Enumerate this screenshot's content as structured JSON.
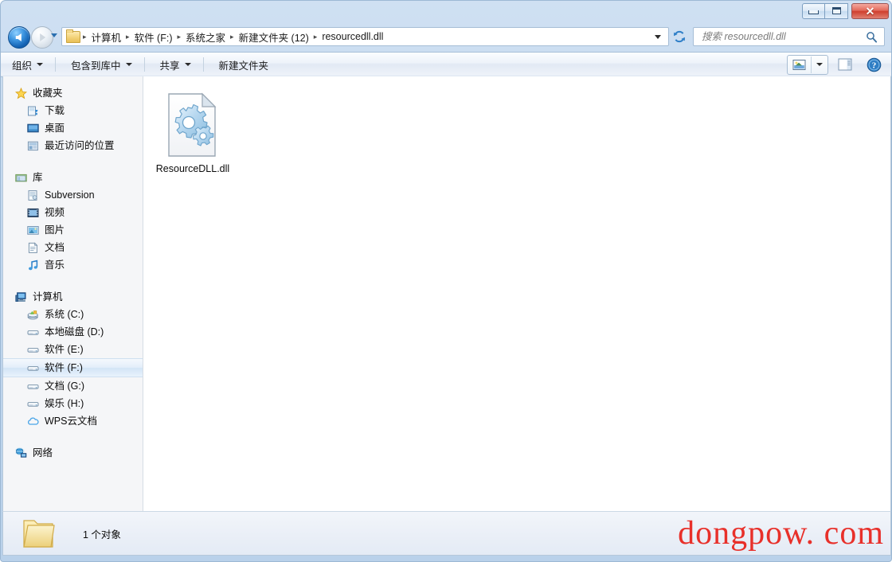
{
  "window": {
    "controls": {
      "minimize_label": "最小化",
      "maximize_label": "最大化",
      "close_label": "✕"
    }
  },
  "navigation": {
    "back_tooltip": "后退",
    "forward_tooltip": "前进",
    "history_tooltip": "最近浏览的位置",
    "refresh_tooltip": "刷新"
  },
  "address": {
    "crumbs": [
      "计算机",
      "软件 (F:)",
      "系统之家",
      "新建文件夹 (12)",
      "resourcedll.dll"
    ],
    "separator": "▸"
  },
  "search": {
    "placeholder": "搜索 resourcedll.dll",
    "value": ""
  },
  "toolbar": {
    "items": [
      {
        "label": "组织",
        "has_caret": true
      },
      {
        "label": "包含到库中",
        "has_caret": true
      },
      {
        "label": "共享",
        "has_caret": true
      },
      {
        "label": "新建文件夹",
        "has_caret": false
      }
    ],
    "view_button": "更改您的视图",
    "view_caret": "视图选项",
    "preview_pane": "显示预览窗格",
    "help": "获取帮助"
  },
  "sidebar": {
    "groups": [
      {
        "header": {
          "label": "收藏夹",
          "icon": "star-icon"
        },
        "items": [
          {
            "label": "下载",
            "icon": "downloads-icon"
          },
          {
            "label": "桌面",
            "icon": "desktop-icon"
          },
          {
            "label": "最近访问的位置",
            "icon": "recent-places-icon"
          }
        ]
      },
      {
        "header": {
          "label": "库",
          "icon": "library-icon"
        },
        "items": [
          {
            "label": "Subversion",
            "icon": "subversion-icon"
          },
          {
            "label": "视频",
            "icon": "videos-icon"
          },
          {
            "label": "图片",
            "icon": "pictures-icon"
          },
          {
            "label": "文档",
            "icon": "documents-icon"
          },
          {
            "label": "音乐",
            "icon": "music-icon"
          }
        ]
      },
      {
        "header": {
          "label": "计算机",
          "icon": "computer-icon"
        },
        "items": [
          {
            "label": "系统 (C:)",
            "icon": "system-drive-icon",
            "selected": false
          },
          {
            "label": "本地磁盘 (D:)",
            "icon": "drive-icon",
            "selected": false
          },
          {
            "label": "软件 (E:)",
            "icon": "drive-icon",
            "selected": false
          },
          {
            "label": "软件 (F:)",
            "icon": "drive-icon",
            "selected": true
          },
          {
            "label": "文档 (G:)",
            "icon": "drive-icon",
            "selected": false
          },
          {
            "label": "娱乐 (H:)",
            "icon": "drive-icon",
            "selected": false
          },
          {
            "label": "WPS云文档",
            "icon": "wps-cloud-icon",
            "selected": false
          }
        ]
      },
      {
        "header": {
          "label": "网络",
          "icon": "network-icon"
        },
        "items": []
      }
    ]
  },
  "content": {
    "files": [
      {
        "name": "ResourceDLL.dll",
        "icon": "dll-file-icon"
      }
    ]
  },
  "status": {
    "item_count_text": "1 个对象",
    "folder_icon": "folder-icon"
  },
  "watermark": {
    "text": "dongpow. com",
    "color": "#e8302a"
  }
}
